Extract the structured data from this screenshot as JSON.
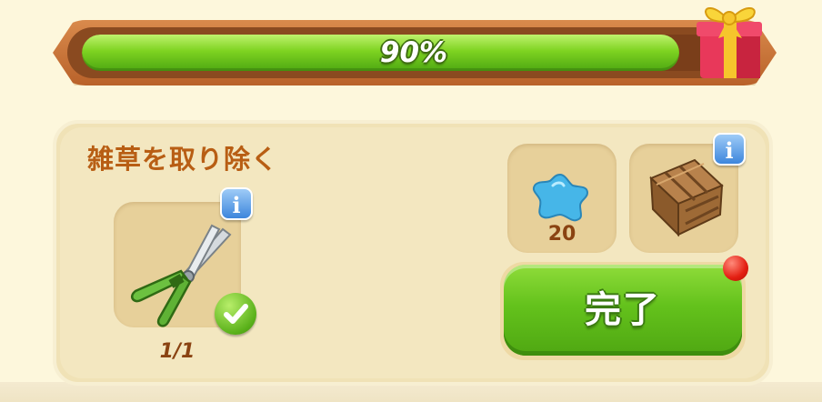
{
  "progress": {
    "value": 0.9,
    "label": "90%",
    "reward_icon": "gift-box-icon",
    "fill_color": "#7ed321"
  },
  "task": {
    "title": "雑草を取り除く",
    "required_item": {
      "icon": "pruning-shears-icon",
      "count_label": "1/1",
      "status_icon": "checkmark-icon",
      "info_icon": "info-icon",
      "info_label": "i"
    },
    "rewards": [
      {
        "icon": "blue-gem-icon",
        "count_label": "20"
      },
      {
        "icon": "wooden-crate-icon",
        "info_icon": "info-icon",
        "info_label": "i"
      }
    ],
    "complete_button": {
      "label": "完了",
      "notification_icon": "red-dot-icon"
    }
  }
}
